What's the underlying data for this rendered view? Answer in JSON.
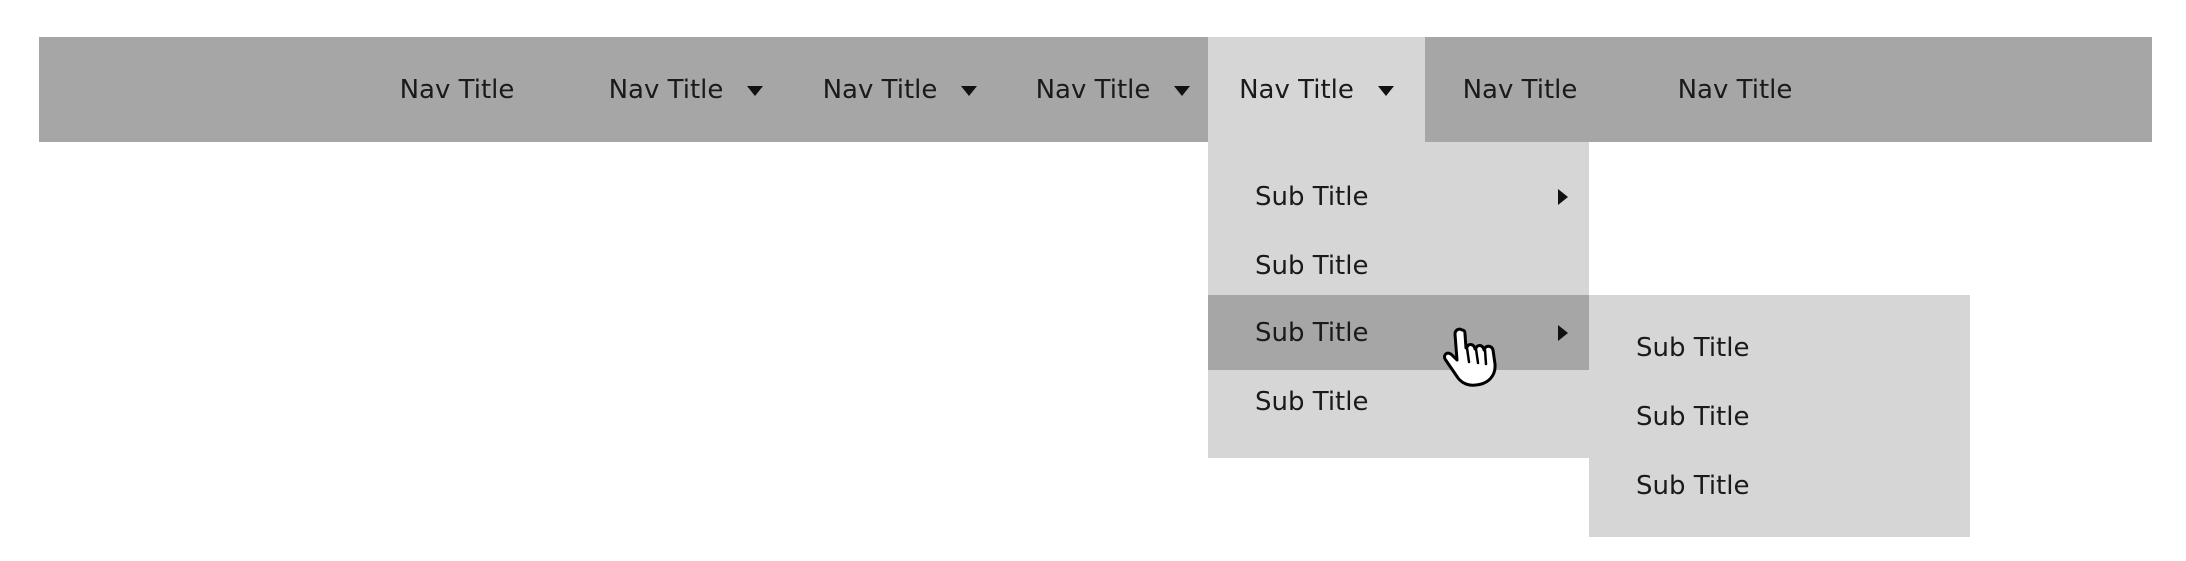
{
  "navbar": {
    "items": [
      {
        "label": "Nav Title",
        "has_dropdown": false
      },
      {
        "label": "Nav Title",
        "has_dropdown": true
      },
      {
        "label": "Nav Title",
        "has_dropdown": true
      },
      {
        "label": "Nav Title",
        "has_dropdown": true
      },
      {
        "label": "Nav Title",
        "has_dropdown": true,
        "active": true
      },
      {
        "label": "Nav Title",
        "has_dropdown": false
      },
      {
        "label": "Nav Title",
        "has_dropdown": false
      }
    ]
  },
  "dropdown": {
    "items": [
      {
        "label": "Sub Title",
        "has_submenu": true
      },
      {
        "label": "Sub Title",
        "has_submenu": false
      },
      {
        "label": "Sub Title",
        "has_submenu": true,
        "hovered": true
      },
      {
        "label": "Sub Title",
        "has_submenu": false
      }
    ]
  },
  "submenu": {
    "items": [
      {
        "label": "Sub Title"
      },
      {
        "label": "Sub Title"
      },
      {
        "label": "Sub Title"
      }
    ]
  },
  "colors": {
    "navbar_bg": "#a6a6a6",
    "active_bg": "#d6d6d6",
    "dropdown_bg": "#d6d6d6",
    "hover_bg": "#a6a6a6",
    "text": "#1a1a1a"
  },
  "cursor": {
    "icon": "hand-pointer-icon"
  }
}
